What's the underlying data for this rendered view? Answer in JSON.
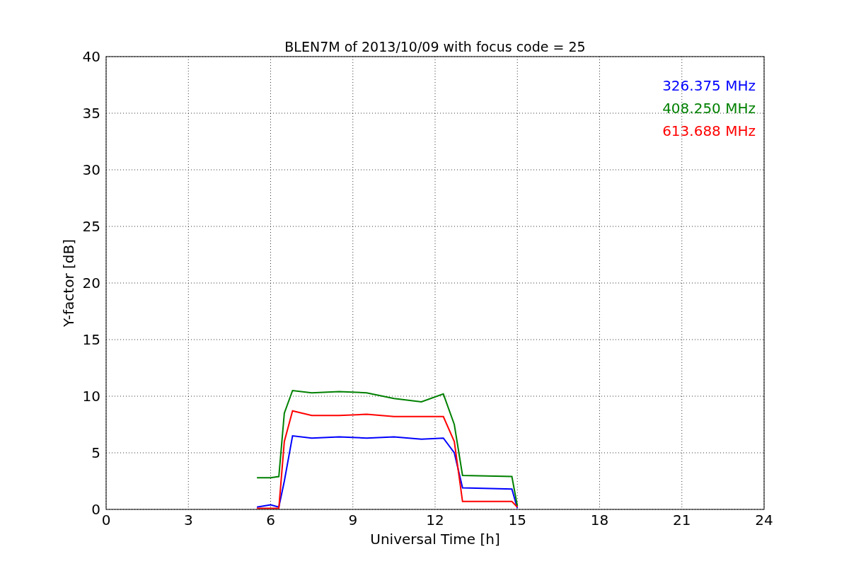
{
  "figure": {
    "chart_data": {
      "type": "line",
      "title": "BLEN7M of 2013/10/09 with focus code = 25",
      "xlabel": "Universal Time [h]",
      "ylabel": "Y-factor [dB]",
      "x": [
        5.5,
        6.0,
        6.3,
        6.5,
        6.8,
        7.5,
        8.5,
        9.5,
        10.5,
        11.5,
        12.3,
        12.7,
        13.0,
        14.8,
        15.0
      ],
      "series": [
        {
          "name": "326.375 MHz",
          "color": "#0000ff",
          "values": [
            0.2,
            0.4,
            0.2,
            2.5,
            6.5,
            6.3,
            6.4,
            6.3,
            6.4,
            6.2,
            6.3,
            5.0,
            1.9,
            1.8,
            0.1
          ]
        },
        {
          "name": "408.250 MHz",
          "color": "#008000",
          "values": [
            2.8,
            2.8,
            2.9,
            8.5,
            10.5,
            10.3,
            10.4,
            10.3,
            9.8,
            9.5,
            10.2,
            7.5,
            3.0,
            2.9,
            0.3
          ]
        },
        {
          "name": "613.688 MHz",
          "color": "#ff0000",
          "values": [
            0.1,
            0.1,
            0.1,
            6.0,
            8.7,
            8.3,
            8.3,
            8.4,
            8.2,
            8.2,
            8.2,
            6.0,
            0.7,
            0.7,
            0.2
          ]
        }
      ],
      "xlim": [
        0,
        24
      ],
      "ylim": [
        0,
        40
      ],
      "xticks": [
        0,
        3,
        6,
        9,
        12,
        15,
        18,
        21,
        24
      ],
      "yticks": [
        0,
        5,
        10,
        15,
        20,
        25,
        30,
        35,
        40
      ],
      "grid": true
    }
  }
}
